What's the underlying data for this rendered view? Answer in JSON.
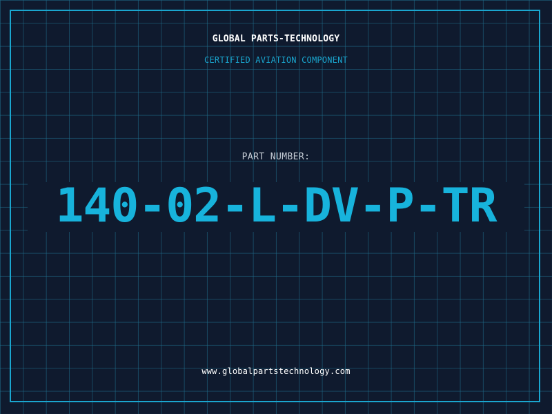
{
  "header": {
    "company_name": "GLOBAL PARTS-TECHNOLOGY",
    "subtitle": "CERTIFIED AVIATION COMPONENT"
  },
  "part": {
    "label": "PART NUMBER:",
    "number": "140-02-L-DV-P-TR"
  },
  "footer": {
    "website": "www.globalpartstechnology.com"
  },
  "colors": {
    "background": "#0f1a2e",
    "accent": "#1aa6cf",
    "grid": "#1f6e8c",
    "text_primary": "#ffffff",
    "text_muted": "#c6cdd6"
  }
}
